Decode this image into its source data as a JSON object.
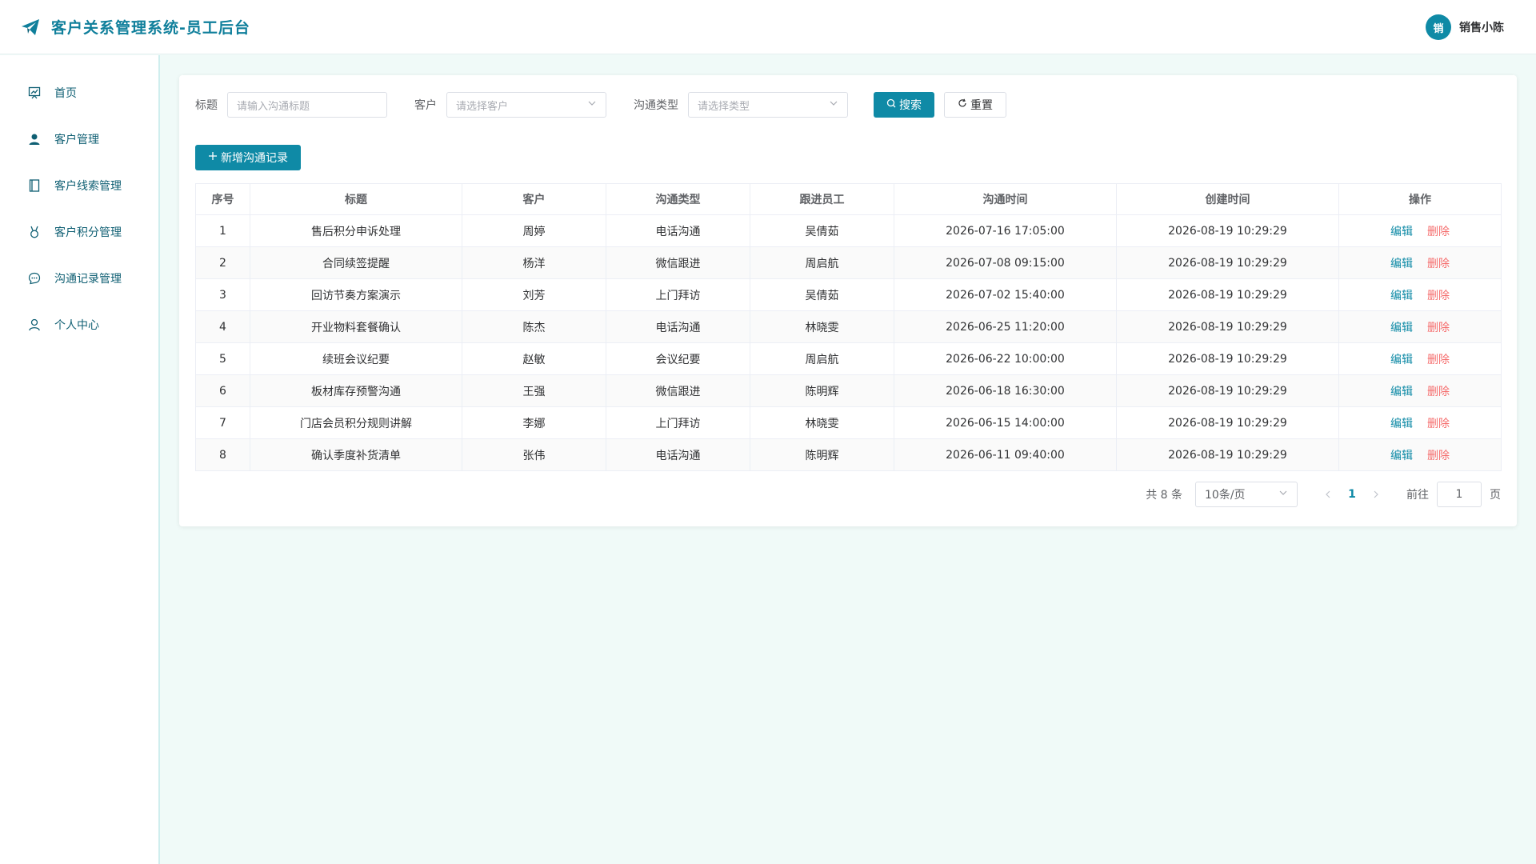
{
  "header": {
    "title": "客户关系管理系统-员工后台",
    "avatar_text": "销",
    "user_name": "销售小陈"
  },
  "sidebar": {
    "items": [
      {
        "label": "首页",
        "icon": "dashboard-icon"
      },
      {
        "label": "客户管理",
        "icon": "user-icon"
      },
      {
        "label": "客户线索管理",
        "icon": "notebook-icon"
      },
      {
        "label": "客户积分管理",
        "icon": "medal-icon"
      },
      {
        "label": "沟通记录管理",
        "icon": "chat-icon"
      },
      {
        "label": "个人中心",
        "icon": "person-icon"
      }
    ]
  },
  "filters": {
    "title_label": "标题",
    "title_placeholder": "请输入沟通标题",
    "customer_label": "客户",
    "customer_placeholder": "请选择客户",
    "type_label": "沟通类型",
    "type_placeholder": "请选择类型",
    "search_label": "搜索",
    "reset_label": "重置"
  },
  "add_button_label": "新增沟通记录",
  "table": {
    "columns": [
      "序号",
      "标题",
      "客户",
      "沟通类型",
      "跟进员工",
      "沟通时间",
      "创建时间",
      "操作"
    ],
    "edit_label": "编辑",
    "delete_label": "删除",
    "rows": [
      {
        "no": "1",
        "title": "售后积分申诉处理",
        "customer": "周婷",
        "type": "电话沟通",
        "staff": "吴倩茹",
        "comm_time": "2026-07-16 17:05:00",
        "created": "2026-08-19 10:29:29"
      },
      {
        "no": "2",
        "title": "合同续签提醒",
        "customer": "杨洋",
        "type": "微信跟进",
        "staff": "周启航",
        "comm_time": "2026-07-08 09:15:00",
        "created": "2026-08-19 10:29:29"
      },
      {
        "no": "3",
        "title": "回访节奏方案演示",
        "customer": "刘芳",
        "type": "上门拜访",
        "staff": "吴倩茹",
        "comm_time": "2026-07-02 15:40:00",
        "created": "2026-08-19 10:29:29"
      },
      {
        "no": "4",
        "title": "开业物料套餐确认",
        "customer": "陈杰",
        "type": "电话沟通",
        "staff": "林晓雯",
        "comm_time": "2026-06-25 11:20:00",
        "created": "2026-08-19 10:29:29"
      },
      {
        "no": "5",
        "title": "续班会议纪要",
        "customer": "赵敏",
        "type": "会议纪要",
        "staff": "周启航",
        "comm_time": "2026-06-22 10:00:00",
        "created": "2026-08-19 10:29:29"
      },
      {
        "no": "6",
        "title": "板材库存预警沟通",
        "customer": "王强",
        "type": "微信跟进",
        "staff": "陈明辉",
        "comm_time": "2026-06-18 16:30:00",
        "created": "2026-08-19 10:29:29"
      },
      {
        "no": "7",
        "title": "门店会员积分规则讲解",
        "customer": "李娜",
        "type": "上门拜访",
        "staff": "林晓雯",
        "comm_time": "2026-06-15 14:00:00",
        "created": "2026-08-19 10:29:29"
      },
      {
        "no": "8",
        "title": "确认季度补货清单",
        "customer": "张伟",
        "type": "电话沟通",
        "staff": "陈明辉",
        "comm_time": "2026-06-11 09:40:00",
        "created": "2026-08-19 10:29:29"
      }
    ]
  },
  "pagination": {
    "total_text": "共 8 条",
    "page_size": "10条/页",
    "current_page": "1",
    "goto_label": "前往",
    "goto_value": "1",
    "page_suffix": "页"
  },
  "colors": {
    "primary": "#0f8aa6",
    "danger": "#f56c6c",
    "background": "#f0faf8"
  }
}
